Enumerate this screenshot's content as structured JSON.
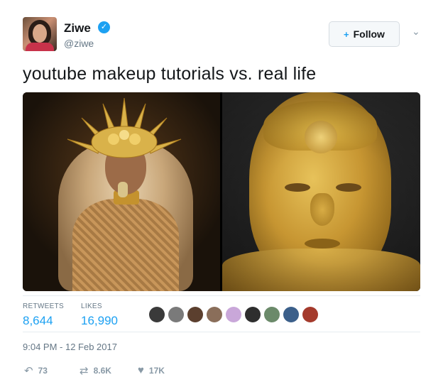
{
  "user": {
    "name": "Ziwe",
    "handle": "@ziwe",
    "verified_badge": "✓",
    "avatar_icon": "profile-photo"
  },
  "follow": {
    "label": "Follow",
    "icon": "+",
    "icon_name": "add-user-icon"
  },
  "menu_chevron": "⌄",
  "tweet": {
    "text": "youtube makeup tutorials vs. real life"
  },
  "stats": {
    "retweets_label": "RETWEETS",
    "retweets_value": "8,644",
    "likes_label": "LIKES",
    "likes_value": "16,990"
  },
  "likers": [
    {
      "color": "#3a3a3a"
    },
    {
      "color": "#7a7a7a"
    },
    {
      "color": "#5b3f2e"
    },
    {
      "color": "#8a6e5a"
    },
    {
      "color": "#c9a7d9"
    },
    {
      "color": "#2e2e2e"
    },
    {
      "color": "#6b8a6a"
    },
    {
      "color": "#3b5f8a"
    },
    {
      "color": "#a43a2c"
    }
  ],
  "timestamp": "9:04 PM - 12 Feb 2017",
  "actions": {
    "reply_count": "73",
    "retweet_count": "8.6K",
    "like_count": "17K"
  },
  "colors": {
    "accent": "#1da1f2",
    "muted": "#657786",
    "text": "#14171a"
  }
}
